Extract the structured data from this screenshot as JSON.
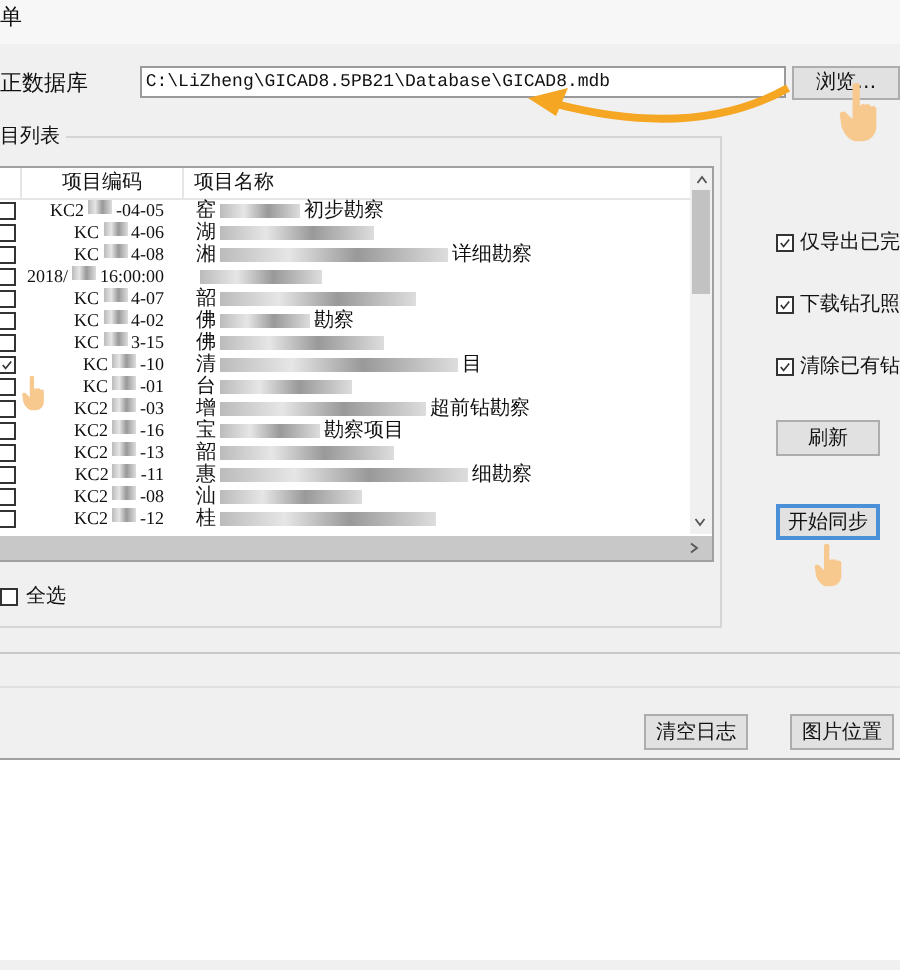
{
  "window": {
    "title": "单"
  },
  "database": {
    "label": "正数据库",
    "path": "C:\\LiZheng\\GICAD8.5PB21\\Database\\GICAD8.mdb",
    "browse_button": "浏览…"
  },
  "project_group": {
    "title": "目列表",
    "columns": [
      "项目编码",
      "项目名称"
    ],
    "rows": [
      {
        "checked": false,
        "code_start": "KC2",
        "code_end": "-04-05",
        "name_start": "窑",
        "name_end": "初步勘察"
      },
      {
        "checked": false,
        "code_start": "KC",
        "code_end": "4-06",
        "name_start": "湖"
      },
      {
        "checked": false,
        "code_start": "KC",
        "code_end": "4-08",
        "name_start": "湘",
        "name_end": "详细勘察"
      },
      {
        "checked": false,
        "code_start": "2018/",
        "code_end": "16:00:00"
      },
      {
        "checked": false,
        "code_start": "KC",
        "code_end": "4-07",
        "name_start": "韶"
      },
      {
        "checked": false,
        "code_start": "KC",
        "code_end": "4-02",
        "name_start": "佛",
        "name_end": "勘察"
      },
      {
        "checked": false,
        "code_start": "KC",
        "code_end": "3-15",
        "name_start": "佛"
      },
      {
        "checked": true,
        "code_start": "KC",
        "code_end": "-10",
        "name_start": "清",
        "name_end": "目"
      },
      {
        "checked": false,
        "code_start": "KC",
        "code_end": "-01",
        "name_start": "台"
      },
      {
        "checked": false,
        "code_start": "KC2",
        "code_end": "-03",
        "name_start": "增",
        "name_end": "超前钻勘察"
      },
      {
        "checked": false,
        "code_start": "KC2",
        "code_end": "-16",
        "name_start": "宝",
        "name_end": "勘察项目"
      },
      {
        "checked": false,
        "code_start": "KC2",
        "code_end": "-13",
        "name_start": "韶"
      },
      {
        "checked": false,
        "code_start": "KC2",
        "code_end": "-11",
        "name_start": "惠",
        "name_end": "细勘察"
      },
      {
        "checked": false,
        "code_start": "KC2",
        "code_end": "-08",
        "name_start": "汕"
      },
      {
        "checked": false,
        "code_start": "KC2",
        "code_end": "-12",
        "name_start": "桂"
      }
    ],
    "select_all": {
      "label": "全选",
      "checked": false
    }
  },
  "options": [
    {
      "label": "仅导出已完",
      "checked": true
    },
    {
      "label": "下载钻孔照",
      "checked": true
    },
    {
      "label": "清除已有钻",
      "checked": true
    }
  ],
  "refresh_button": "刷新",
  "sync_button": {
    "label": "开始同步",
    "focused": true
  },
  "log_buttons": [
    "清空日志",
    "图片位置"
  ]
}
